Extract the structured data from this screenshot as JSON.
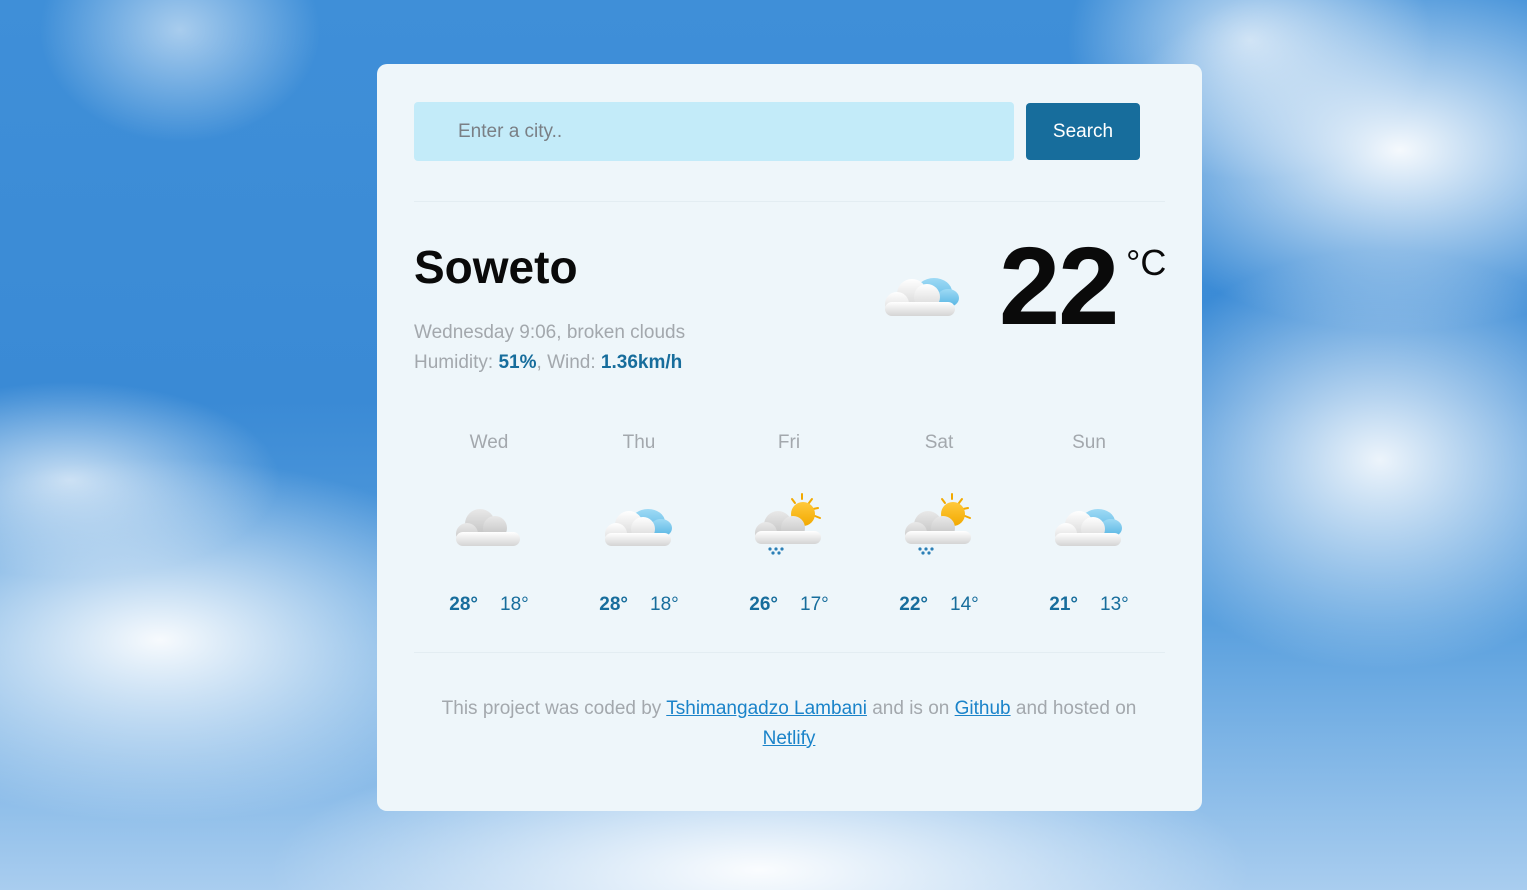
{
  "search": {
    "placeholder": "Enter a city..",
    "button_label": "Search"
  },
  "current": {
    "city": "Soweto",
    "day_time": "Wednesday 9:06",
    "description": "broken clouds",
    "humidity_label": "Humidity:",
    "humidity_value": "51%",
    "wind_label": "Wind:",
    "wind_value": "1.36km/h",
    "temperature": "22",
    "unit": "°C",
    "icon": "broken-clouds-icon"
  },
  "forecast": [
    {
      "day": "Wed",
      "max": "28°",
      "min": "18°",
      "icon": "broken-clouds-icon"
    },
    {
      "day": "Thu",
      "max": "28°",
      "min": "18°",
      "icon": "few-clouds-icon"
    },
    {
      "day": "Fri",
      "max": "26°",
      "min": "17°",
      "icon": "sun-rain-icon"
    },
    {
      "day": "Sat",
      "max": "22°",
      "min": "14°",
      "icon": "sun-rain-icon"
    },
    {
      "day": "Sun",
      "max": "21°",
      "min": "13°",
      "icon": "few-clouds-icon"
    }
  ],
  "footer": {
    "text1": "This project was coded by",
    "author_link": "Tshimangadzo Lambani",
    "text2": "and is on",
    "github_link": "Github",
    "text3": "and hosted on",
    "netlify_link": "Netlify"
  },
  "colors": {
    "accent": "#176d9c",
    "card_background": "#eef6fa",
    "input_background": "#c3ebf9",
    "muted_text": "#a3a8ad",
    "link": "#1a83c9"
  }
}
